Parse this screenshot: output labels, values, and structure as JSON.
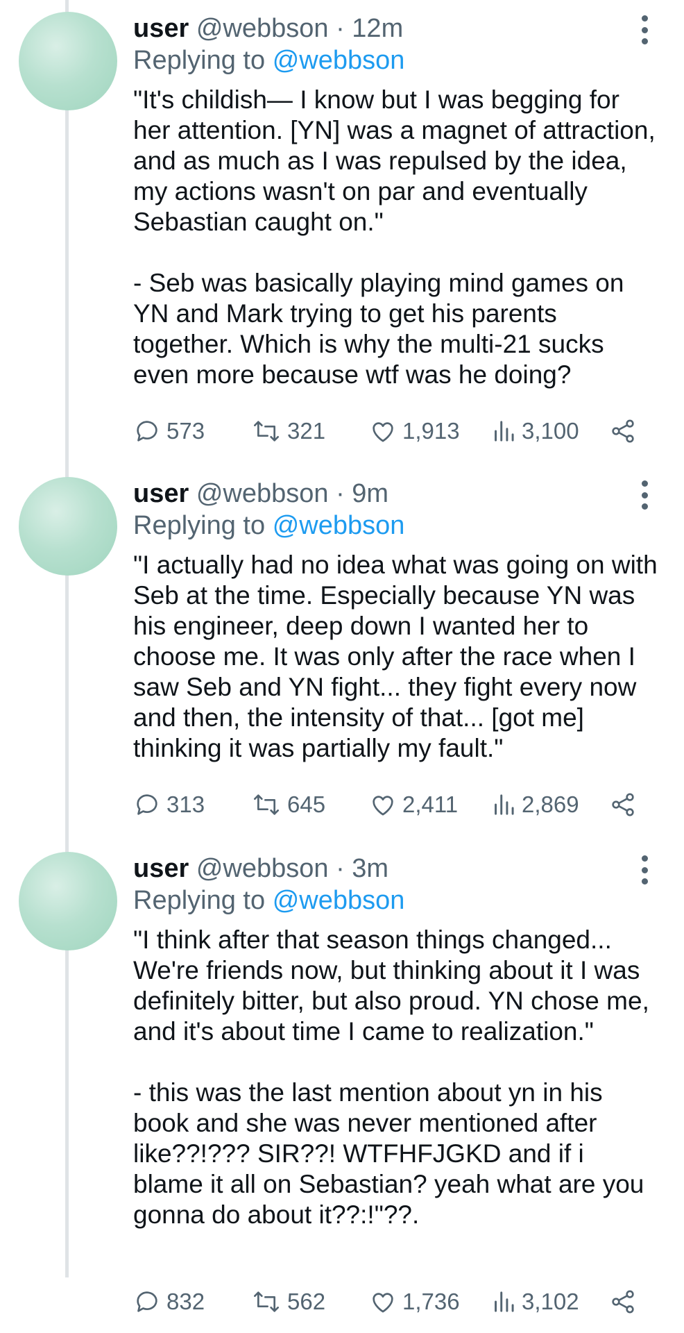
{
  "tweets": [
    {
      "display_name": "user",
      "handle_time": "@webbson · 12m",
      "replying_prefix": "Replying to",
      "replying_handle": "@webbson",
      "body": "\"It's childish— I know but I was begging for her attention. [YN] was a magnet of attraction, and as much as I was repulsed by the idea, my actions wasn't on par and eventually Sebastian caught on.\"\n\n- Seb was basically playing mind games on YN and Mark trying to get his parents together. Which is why the multi-21 sucks even more because wtf was he doing?",
      "replies": "573",
      "retweets": "321",
      "likes": "1,913",
      "views": "3,100"
    },
    {
      "display_name": "user",
      "handle_time": "@webbson · 9m",
      "replying_prefix": "Replying to",
      "replying_handle": "@webbson",
      "body": "\"I actually had no idea what was going on with Seb at the time. Especially because YN was his engineer, deep down I wanted her to choose me. It was only after the race when I saw Seb and YN fight... they fight every now and then, the intensity of that... [got me] thinking it was partially my fault.\"",
      "replies": "313",
      "retweets": "645",
      "likes": "2,411",
      "views": "2,869"
    },
    {
      "display_name": "user",
      "handle_time": "@webbson · 3m",
      "replying_prefix": "Replying to",
      "replying_handle": "@webbson",
      "body": "\"I think after that season things changed... We're friends now, but thinking about it I was definitely bitter, but also proud. YN chose me, and it's about time I came to realization.\"\n\n- this was the last mention about yn in his book and she was never mentioned after like??!??? SIR??! WTFHFJGKD and if i blame it all on Sebastian? yeah what are you gonna do about it??:!\"??.",
      "replies": "832",
      "retweets": "562",
      "likes": "1,736",
      "views": "3,102"
    }
  ],
  "icons": [
    "reply-icon",
    "retweet-icon",
    "like-icon",
    "views-icon",
    "share-icon",
    "more-options-icon"
  ],
  "colors": {
    "text": "#0f1419",
    "muted": "#536471",
    "link": "#1d9bf0",
    "avatar": "#b7e0cf",
    "thread_line": "#dfe3e6"
  }
}
